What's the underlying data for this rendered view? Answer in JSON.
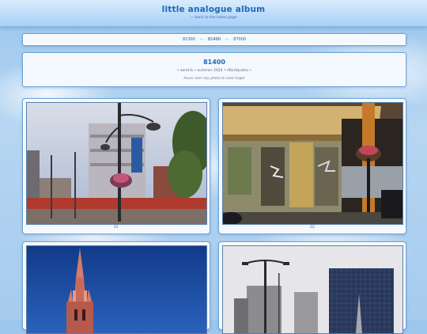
{
  "header": {
    "site_title": "little analogue album",
    "back_link": "— back to the index page"
  },
  "breadcrumb": {
    "items": [
      "81300",
      "81400",
      "87000"
    ],
    "separator": "—",
    "current_index": 1
  },
  "roll": {
    "title": "81400",
    "meta": "• zenit-b • summer 2024 • ilford/praha •",
    "hint": "hover over any photo to view larger"
  },
  "photos": [
    {
      "label": "01",
      "subject": "street scene with lamp post and buildings"
    },
    {
      "label": "02",
      "subject": "abandoned building with graffiti"
    },
    {
      "label": "",
      "subject": "red church spire against blue sky"
    },
    {
      "label": "",
      "subject": "street lamp and modern towers"
    }
  ],
  "colors": {
    "accent": "#1f67b8",
    "panel_bg": "#f4f9ff",
    "panel_border": "#6aa2d9"
  }
}
